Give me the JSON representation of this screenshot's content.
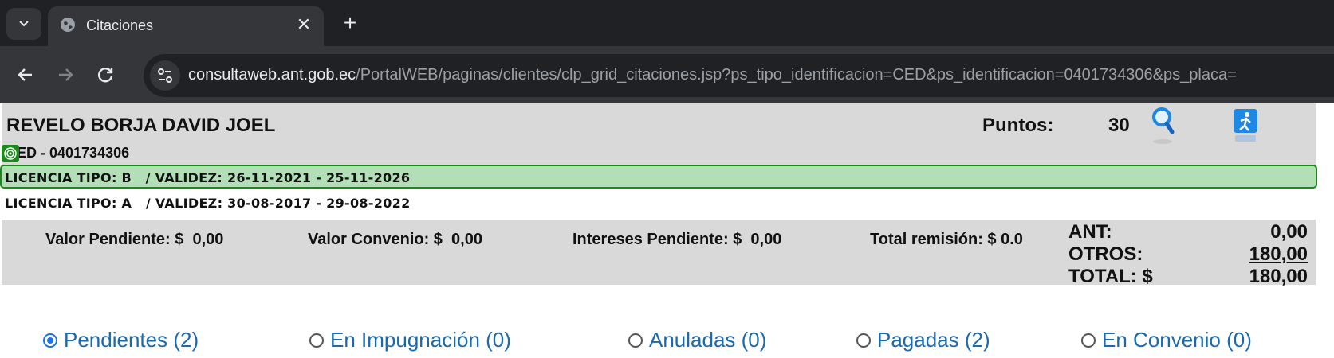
{
  "browser": {
    "tab_title": "Citaciones",
    "url_host": "consultaweb.ant.gob.ec",
    "url_path": "/PortalWEB/paginas/clientes/clp_grid_citaciones.jsp?ps_tipo_identificacion=CED&ps_identificacion=0401734306&ps_placa="
  },
  "header": {
    "name": "REVELO BORJA DAVID JOEL",
    "puntos_label": "Puntos:",
    "puntos_value": "30",
    "cedula": "CED - 0401734306"
  },
  "licenses": [
    {
      "text": "LICENCIA TIPO: B   / VALIDEZ: 26-11-2021 - 25-11-2026"
    },
    {
      "text": "LICENCIA TIPO: A   / VALIDEZ: 30-08-2017 - 29-08-2022"
    }
  ],
  "summary": {
    "valor_pendiente": "Valor Pendiente: $  0,00",
    "valor_convenio": "Valor Convenio: $  0,00",
    "intereses_pendiente": "Intereses Pendiente: $  0,00",
    "total_remision": "Total remisión: $ 0.0",
    "ant_label": "ANT:",
    "ant_value": "0,00",
    "otros_label": "OTROS:",
    "otros_value": "180,00",
    "total_label": "TOTAL: $",
    "total_value": "180,00"
  },
  "filters": [
    {
      "label": "Pendientes (2)",
      "checked": true
    },
    {
      "label": "En Impugnación (0)",
      "checked": false
    },
    {
      "label": "Anuladas (0)",
      "checked": false
    },
    {
      "label": "Pagadas (2)",
      "checked": false
    },
    {
      "label": "En Convenio (0)",
      "checked": false
    }
  ],
  "colors": {
    "highlight": "#b2dfb5",
    "highlight_border": "#1a8a1a",
    "band": "#d9d9d9",
    "radio_label": "#1a6ab0"
  }
}
